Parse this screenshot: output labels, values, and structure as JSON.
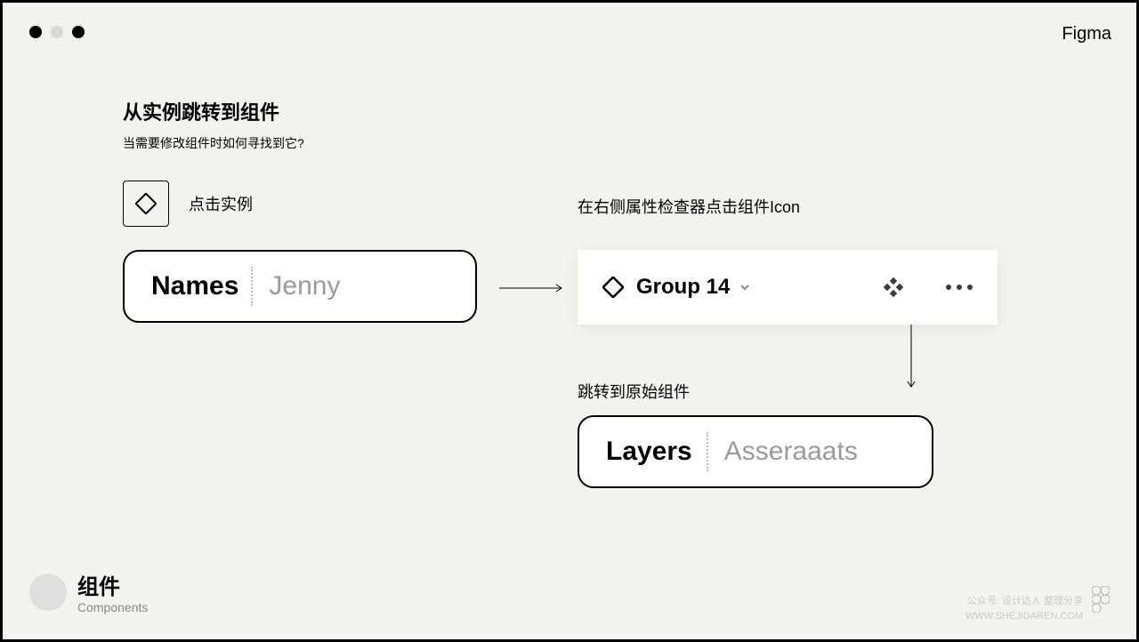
{
  "app_name": "Figma",
  "heading": {
    "title": "从实例跳转到组件",
    "subtitle": "当需要修改组件时如何寻找到它?"
  },
  "step1": {
    "label": "点击实例",
    "card": {
      "label": "Names",
      "value": "Jenny"
    }
  },
  "step2": {
    "label": "在右侧属性检查器点击组件Icon",
    "component_name": "Group 14"
  },
  "step3": {
    "label": "跳转到原始组件",
    "card": {
      "label": "Layers",
      "value": "Asseraaats"
    }
  },
  "footer": {
    "title_cn": "组件",
    "title_en": "Components"
  },
  "watermark": {
    "line1": "公众号: 设计达人 整理分享",
    "line2": "WWW.SHEJIDAREN.COM"
  }
}
